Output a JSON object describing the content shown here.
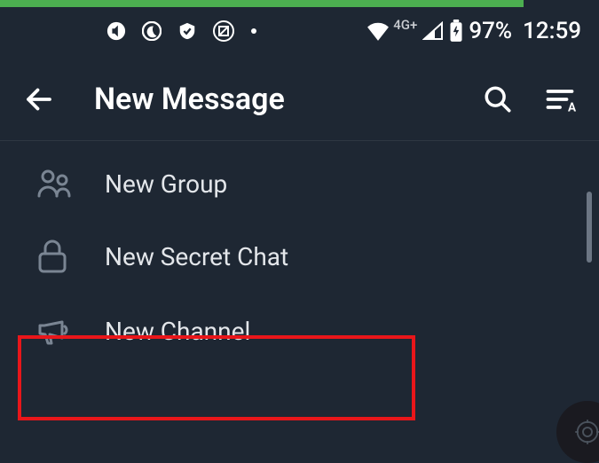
{
  "status": {
    "network_label": "4G+",
    "battery_percent": "97%",
    "time": "12:59"
  },
  "toolbar": {
    "title": "New Message"
  },
  "menu": {
    "new_group": "New Group",
    "new_secret_chat": "New Secret Chat",
    "new_channel": "New Channel"
  }
}
